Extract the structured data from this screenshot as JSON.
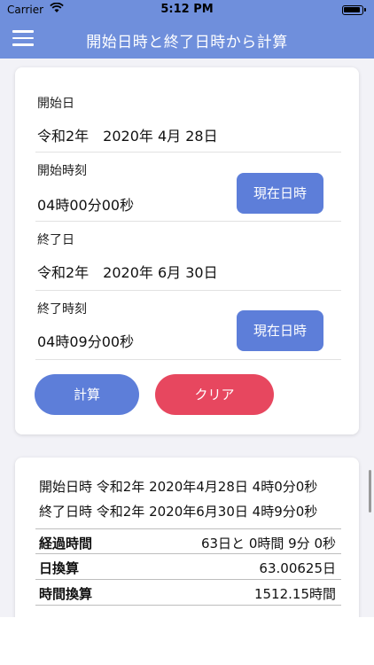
{
  "status_bar": {
    "carrier": "Carrier",
    "time": "5:12 PM"
  },
  "nav": {
    "title": "開始日時と終了日時から計算"
  },
  "form": {
    "start_date_label": "開始日",
    "start_date_value": "令和2年　2020年 4月 28日",
    "start_time_label": "開始時刻",
    "start_time_value": "04時00分00秒",
    "end_date_label": "終了日",
    "end_date_value": "令和2年　2020年 6月 30日",
    "end_time_label": "終了時刻",
    "end_time_value": "04時09分00秒",
    "now_button_label": "現在日時",
    "calc_button_label": "計算",
    "clear_button_label": "クリア"
  },
  "result": {
    "start_line": "開始日時 令和2年 2020年4月28日 4時0分0秒",
    "end_line": "終了日時 令和2年 2020年6月30日 4時9分0秒",
    "rows": [
      {
        "label": "経過時間",
        "value": "63日と 0時間 9分 0秒"
      },
      {
        "label": "日換算",
        "value": "63.00625日"
      },
      {
        "label": "時間換算",
        "value": "1512.15時間"
      }
    ]
  },
  "colors": {
    "header": "#6f8fdc",
    "primary_button": "#5d7ed9",
    "clear_button": "#e7475f"
  }
}
